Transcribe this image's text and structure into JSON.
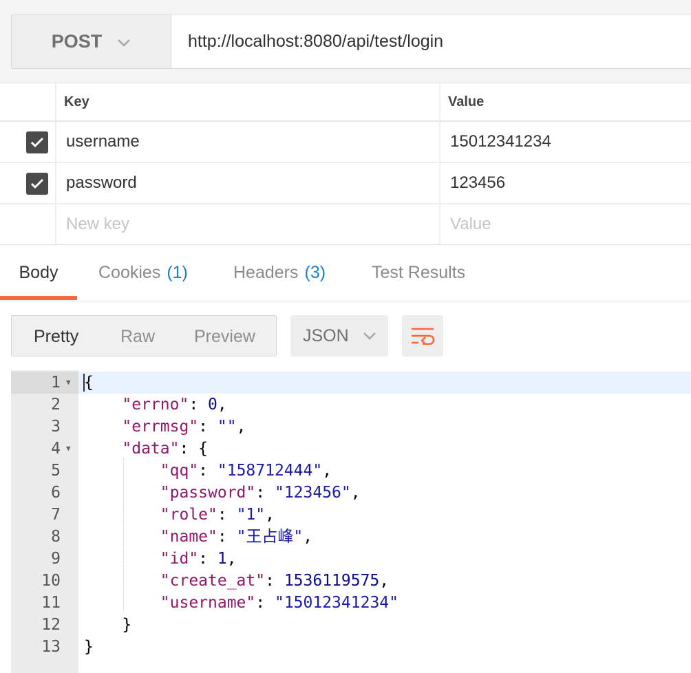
{
  "request": {
    "method": "POST",
    "url": "http://localhost:8080/api/test/login"
  },
  "params": {
    "headers": {
      "key": "Key",
      "value": "Value"
    },
    "rows": [
      {
        "checked": true,
        "key": "username",
        "value": "15012341234"
      },
      {
        "checked": true,
        "key": "password",
        "value": "123456"
      }
    ],
    "new_key_placeholder": "New key",
    "new_value_placeholder": "Value"
  },
  "response_tabs": {
    "body": "Body",
    "cookies": {
      "label": "Cookies",
      "count": "(1)"
    },
    "headers": {
      "label": "Headers",
      "count": "(3)"
    },
    "test_results": "Test Results"
  },
  "view_modes": {
    "pretty": "Pretty",
    "raw": "Raw",
    "preview": "Preview"
  },
  "format": "JSON",
  "icons": {
    "method_dropdown": "chevron-down-icon",
    "format_dropdown": "chevron-down-icon",
    "wrap": "wrap-lines-icon",
    "checkbox": "check-icon"
  },
  "colors": {
    "accent": "#f26b3a",
    "count": "#1b7ed3",
    "json_key": "#92186b",
    "json_string": "#1a1aa6",
    "json_number": "#0d0d8a"
  },
  "code": {
    "line_numbers": [
      "1",
      "2",
      "3",
      "4",
      "5",
      "6",
      "7",
      "8",
      "9",
      "10",
      "11",
      "12",
      "13"
    ],
    "lines": [
      {
        "tokens": [
          {
            "t": "p",
            "v": "{"
          }
        ]
      },
      {
        "tokens": [
          {
            "t": "p",
            "v": "    "
          },
          {
            "t": "k",
            "v": "\"errno\""
          },
          {
            "t": "p",
            "v": ": "
          },
          {
            "t": "n",
            "v": "0"
          },
          {
            "t": "p",
            "v": ","
          }
        ]
      },
      {
        "tokens": [
          {
            "t": "p",
            "v": "    "
          },
          {
            "t": "k",
            "v": "\"errmsg\""
          },
          {
            "t": "p",
            "v": ": "
          },
          {
            "t": "s",
            "v": "\"\""
          },
          {
            "t": "p",
            "v": ","
          }
        ]
      },
      {
        "tokens": [
          {
            "t": "p",
            "v": "    "
          },
          {
            "t": "k",
            "v": "\"data\""
          },
          {
            "t": "p",
            "v": ": {"
          }
        ]
      },
      {
        "tokens": [
          {
            "t": "p",
            "v": "        "
          },
          {
            "t": "k",
            "v": "\"qq\""
          },
          {
            "t": "p",
            "v": ": "
          },
          {
            "t": "s",
            "v": "\"158712444\""
          },
          {
            "t": "p",
            "v": ","
          }
        ]
      },
      {
        "tokens": [
          {
            "t": "p",
            "v": "        "
          },
          {
            "t": "k",
            "v": "\"password\""
          },
          {
            "t": "p",
            "v": ": "
          },
          {
            "t": "s",
            "v": "\"123456\""
          },
          {
            "t": "p",
            "v": ","
          }
        ]
      },
      {
        "tokens": [
          {
            "t": "p",
            "v": "        "
          },
          {
            "t": "k",
            "v": "\"role\""
          },
          {
            "t": "p",
            "v": ": "
          },
          {
            "t": "s",
            "v": "\"1\""
          },
          {
            "t": "p",
            "v": ","
          }
        ]
      },
      {
        "tokens": [
          {
            "t": "p",
            "v": "        "
          },
          {
            "t": "k",
            "v": "\"name\""
          },
          {
            "t": "p",
            "v": ": "
          },
          {
            "t": "s",
            "v": "\"王占峰\""
          },
          {
            "t": "p",
            "v": ","
          }
        ]
      },
      {
        "tokens": [
          {
            "t": "p",
            "v": "        "
          },
          {
            "t": "k",
            "v": "\"id\""
          },
          {
            "t": "p",
            "v": ": "
          },
          {
            "t": "n",
            "v": "1"
          },
          {
            "t": "p",
            "v": ","
          }
        ]
      },
      {
        "tokens": [
          {
            "t": "p",
            "v": "        "
          },
          {
            "t": "k",
            "v": "\"create_at\""
          },
          {
            "t": "p",
            "v": ": "
          },
          {
            "t": "n",
            "v": "1536119575"
          },
          {
            "t": "p",
            "v": ","
          }
        ]
      },
      {
        "tokens": [
          {
            "t": "p",
            "v": "        "
          },
          {
            "t": "k",
            "v": "\"username\""
          },
          {
            "t": "p",
            "v": ": "
          },
          {
            "t": "s",
            "v": "\"15012341234\""
          }
        ]
      },
      {
        "tokens": [
          {
            "t": "p",
            "v": "    }"
          }
        ]
      },
      {
        "tokens": [
          {
            "t": "p",
            "v": "}"
          }
        ]
      }
    ]
  }
}
